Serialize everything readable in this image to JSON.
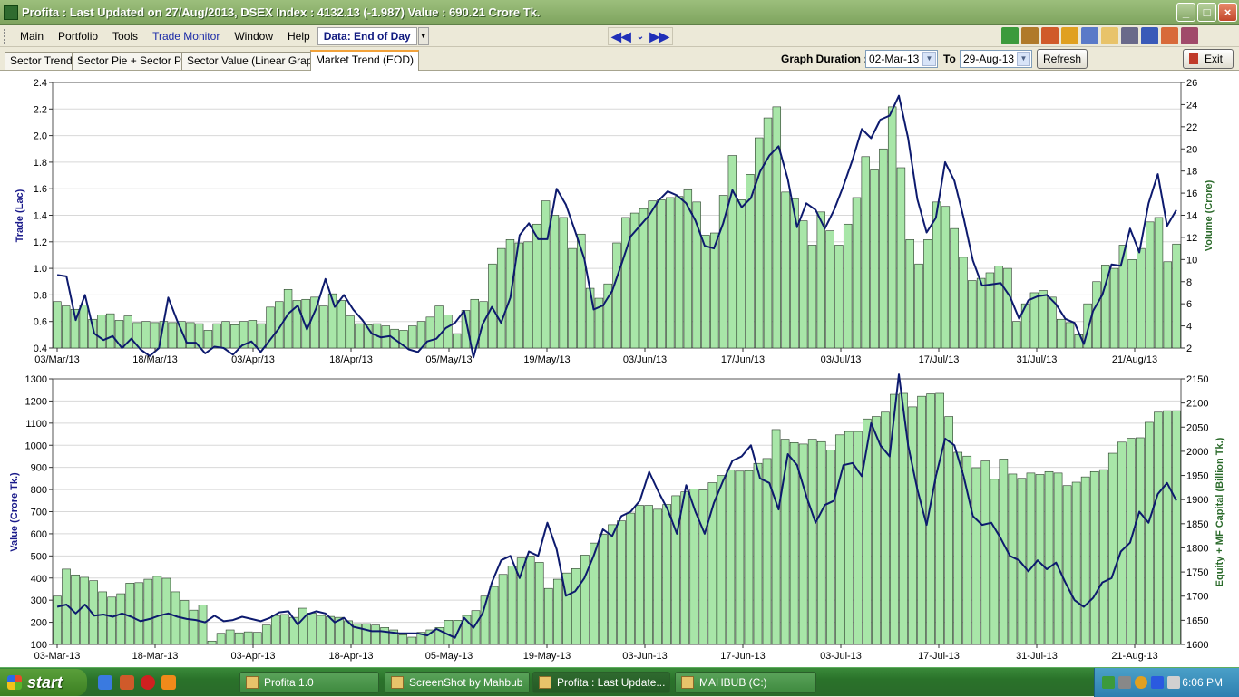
{
  "window": {
    "title": "Profita : Last Updated on 27/Aug/2013,  DSEX Index : 4132.13 (-1.987)  Value : 690.21 Crore Tk."
  },
  "menu": {
    "items": [
      "Main",
      "Portfolio",
      "Tools",
      "Trade Monitor",
      "Window",
      "Help"
    ],
    "data_mode": "Data: End of Day"
  },
  "tabs": [
    "Sector Trend",
    "Sector Pie + Sector PE",
    "Sector Value (Linear Graph)",
    "Market Trend (EOD)"
  ],
  "active_tab": "Market Trend (EOD)",
  "duration": {
    "label": "Graph Duration :",
    "from": "02-Mar-13",
    "to_label": "To",
    "to": "29-Aug-13",
    "refresh_label": "Refresh",
    "exit_label": "Exit"
  },
  "colors": {
    "bar_fill": "#a8e6a8",
    "bar_stroke": "#2a3a2a",
    "line": "#0d1a6e",
    "trade_axis": "#1a1a8a",
    "volume_axis": "#2a6a2a"
  },
  "chart_data": [
    {
      "type": "bar",
      "title": "",
      "ylabel_left": "Trade (Lac)",
      "ylabel_right": "Volume (Crore)",
      "ylim_left": [
        0.4,
        2.4
      ],
      "ylim_right": [
        2,
        26
      ],
      "left_ticks": [
        "2.4",
        "2.2",
        "2.0",
        "1.8",
        "1.6",
        "1.4",
        "1.2",
        "1.0",
        "0.8",
        "0.6",
        "0.4"
      ],
      "right_ticks": [
        "26",
        "24",
        "22",
        "20",
        "18",
        "16",
        "14",
        "12",
        "10",
        "8",
        "6",
        "4",
        "2"
      ],
      "x_tick_labels": [
        "03/Mar/13",
        "18/Mar/13",
        "03/Apr/13",
        "18/Apr/13",
        "05/May/13",
        "19/May/13",
        "03/Jun/13",
        "17/Jun/13",
        "03/Jul/13",
        "17/Jul/13",
        "31/Jul/13",
        "21/Aug/13"
      ],
      "series": [
        {
          "name": "Volume (Crore)",
          "axis": "right",
          "render": "bar",
          "values": [
            6.2,
            5.8,
            5.5,
            5.9,
            4.6,
            5.0,
            5.1,
            4.5,
            4.9,
            4.3,
            4.4,
            4.3,
            4.4,
            4.3,
            4.4,
            4.3,
            4.2,
            3.6,
            4.2,
            4.4,
            4.1,
            4.4,
            4.5,
            4.2,
            5.7,
            6.2,
            7.3,
            6.3,
            6.4,
            6.6,
            5.8,
            6.9,
            6.3,
            4.9,
            4.2,
            4.1,
            4.2,
            4.0,
            3.7,
            3.6,
            4.0,
            4.4,
            4.8,
            5.8,
            5.0,
            3.3,
            5.4,
            6.4,
            6.2,
            9.6,
            11.0,
            11.8,
            11.5,
            11.6,
            13.2,
            15.3,
            14.0,
            13.8,
            11.0,
            12.3,
            7.4,
            6.5,
            7.8,
            11.5,
            13.8,
            14.2,
            14.6,
            15.3,
            15.4,
            15.6,
            15.7,
            16.3,
            15.2,
            12.2,
            12.4,
            15.8,
            19.4,
            15.4,
            17.7,
            21.0,
            22.8,
            23.8,
            16.1,
            15.5,
            13.5,
            11.3,
            14.3,
            12.6,
            11.3,
            13.2,
            15.6,
            19.3,
            18.1,
            20.0,
            23.8,
            18.3,
            11.8,
            9.6,
            11.8,
            15.2,
            14.8,
            12.8,
            10.2,
            8.1,
            8.3,
            8.8,
            9.4,
            9.2,
            4.4,
            6.0,
            7.0,
            7.2,
            6.6,
            4.6,
            4.3,
            3.2,
            6.0,
            8.0,
            9.5,
            9.2,
            11.3,
            10.0,
            11.0,
            13.4,
            13.8,
            9.8,
            11.4
          ]
        },
        {
          "name": "Trade (Lac)",
          "axis": "left",
          "render": "line",
          "values": [
            0.95,
            0.94,
            0.61,
            0.8,
            0.51,
            0.46,
            0.49,
            0.4,
            0.47,
            0.39,
            0.34,
            0.4,
            0.78,
            0.6,
            0.44,
            0.44,
            0.36,
            0.41,
            0.4,
            0.35,
            0.42,
            0.45,
            0.37,
            0.46,
            0.55,
            0.66,
            0.72,
            0.54,
            0.7,
            0.92,
            0.71,
            0.8,
            0.69,
            0.61,
            0.51,
            0.48,
            0.49,
            0.44,
            0.39,
            0.37,
            0.45,
            0.47,
            0.55,
            0.59,
            0.68,
            0.33,
            0.58,
            0.71,
            0.59,
            0.78,
            1.25,
            1.34,
            1.22,
            1.22,
            1.6,
            1.48,
            1.28,
            1.07,
            0.69,
            0.72,
            0.83,
            1.03,
            1.24,
            1.32,
            1.4,
            1.51,
            1.58,
            1.55,
            1.49,
            1.36,
            1.17,
            1.15,
            1.34,
            1.59,
            1.46,
            1.53,
            1.73,
            1.85,
            1.92,
            1.67,
            1.31,
            1.49,
            1.44,
            1.3,
            1.44,
            1.62,
            1.82,
            2.05,
            1.98,
            2.12,
            2.15,
            2.3,
            1.98,
            1.52,
            1.27,
            1.38,
            1.8,
            1.66,
            1.38,
            1.06,
            0.87,
            0.88,
            0.89,
            0.79,
            0.62,
            0.76,
            0.79,
            0.8,
            0.73,
            0.62,
            0.59,
            0.43,
            0.68,
            0.8,
            1.03,
            1.02,
            1.3,
            1.12,
            1.49,
            1.71,
            1.32,
            1.44
          ]
        }
      ]
    },
    {
      "type": "bar",
      "title": "",
      "ylabel_left": "Value (Crore Tk.)",
      "ylabel_right": "Equity + MF Capital (Billion Tk.)",
      "ylim_left": [
        100,
        1300
      ],
      "ylim_right": [
        1600,
        2150
      ],
      "left_ticks": [
        "1300",
        "1200",
        "1100",
        "1000",
        "900",
        "800",
        "700",
        "600",
        "500",
        "400",
        "300",
        "200",
        "100"
      ],
      "right_ticks": [
        "2150",
        "2100",
        "2050",
        "2000",
        "1950",
        "1900",
        "1850",
        "1800",
        "1750",
        "1700",
        "1650",
        "1600"
      ],
      "x_tick_labels": [
        "03-Mar-13",
        "18-Mar-13",
        "03-Apr-13",
        "18-Apr-13",
        "05-May-13",
        "19-May-13",
        "03-Jun-13",
        "17-Jun-13",
        "03-Jul-13",
        "17-Jul-13",
        "31-Jul-13",
        "21-Aug-13"
      ],
      "series": [
        {
          "name": "Equity + MF Capital (Billion Tk.)",
          "axis": "right",
          "render": "bar",
          "values": [
            1700,
            1756,
            1744,
            1739,
            1732,
            1709,
            1698,
            1705,
            1727,
            1728,
            1735,
            1741,
            1737,
            1709,
            1691,
            1671,
            1682,
            1607,
            1623,
            1630,
            1624,
            1626,
            1625,
            1640,
            1660,
            1662,
            1656,
            1675,
            1665,
            1660,
            1658,
            1656,
            1649,
            1643,
            1643,
            1640,
            1635,
            1630,
            1620,
            1615,
            1625,
            1630,
            1635,
            1650,
            1650,
            1660,
            1670,
            1700,
            1720,
            1745,
            1762,
            1779,
            1783,
            1770,
            1716,
            1735,
            1748,
            1757,
            1785,
            1810,
            1828,
            1848,
            1856,
            1872,
            1888,
            1888,
            1880,
            1890,
            1908,
            1916,
            1922,
            1920,
            1935,
            1950,
            1961,
            1959,
            1960,
            1975,
            1985,
            2045,
            2025,
            2018,
            2015,
            2025,
            2020,
            2003,
            2034,
            2041,
            2041,
            2067,
            2072,
            2081,
            2118,
            2120,
            2092,
            2114,
            2119,
            2120,
            2072,
            1998,
            1990,
            1966,
            1980,
            1942,
            1984,
            1953,
            1944,
            1955,
            1952,
            1958,
            1955,
            1929,
            1936,
            1947,
            1958,
            1962,
            1996,
            2019,
            2027,
            2028,
            2060,
            2081,
            2084,
            2084
          ]
        },
        {
          "name": "Value (Crore Tk.)",
          "axis": "left",
          "render": "line",
          "values": [
            270,
            280,
            240,
            280,
            230,
            235,
            225,
            240,
            225,
            205,
            215,
            230,
            240,
            225,
            215,
            210,
            200,
            230,
            205,
            210,
            225,
            215,
            205,
            220,
            245,
            250,
            190,
            235,
            250,
            240,
            200,
            220,
            180,
            170,
            160,
            160,
            155,
            150,
            150,
            150,
            140,
            170,
            150,
            130,
            220,
            175,
            240,
            380,
            480,
            500,
            400,
            520,
            500,
            650,
            530,
            320,
            340,
            400,
            500,
            620,
            590,
            680,
            700,
            750,
            880,
            790,
            710,
            600,
            820,
            700,
            600,
            740,
            840,
            930,
            950,
            1000,
            850,
            830,
            710,
            960,
            910,
            770,
            650,
            730,
            750,
            910,
            920,
            860,
            1100,
            1000,
            950,
            1320,
            1000,
            800,
            640,
            860,
            1030,
            1000,
            860,
            680,
            640,
            650,
            580,
            500,
            480,
            430,
            480,
            440,
            470,
            380,
            300,
            270,
            310,
            380,
            400,
            520,
            560,
            700,
            650,
            780,
            830,
            750
          ]
        }
      ]
    }
  ],
  "taskbar": {
    "start_label": "start",
    "tasks": [
      "Profita 1.0",
      "ScreenShot by Mahbub",
      "Profita : Last Update...",
      "MAHBUB (C:)"
    ],
    "clock": "6:06 PM"
  }
}
